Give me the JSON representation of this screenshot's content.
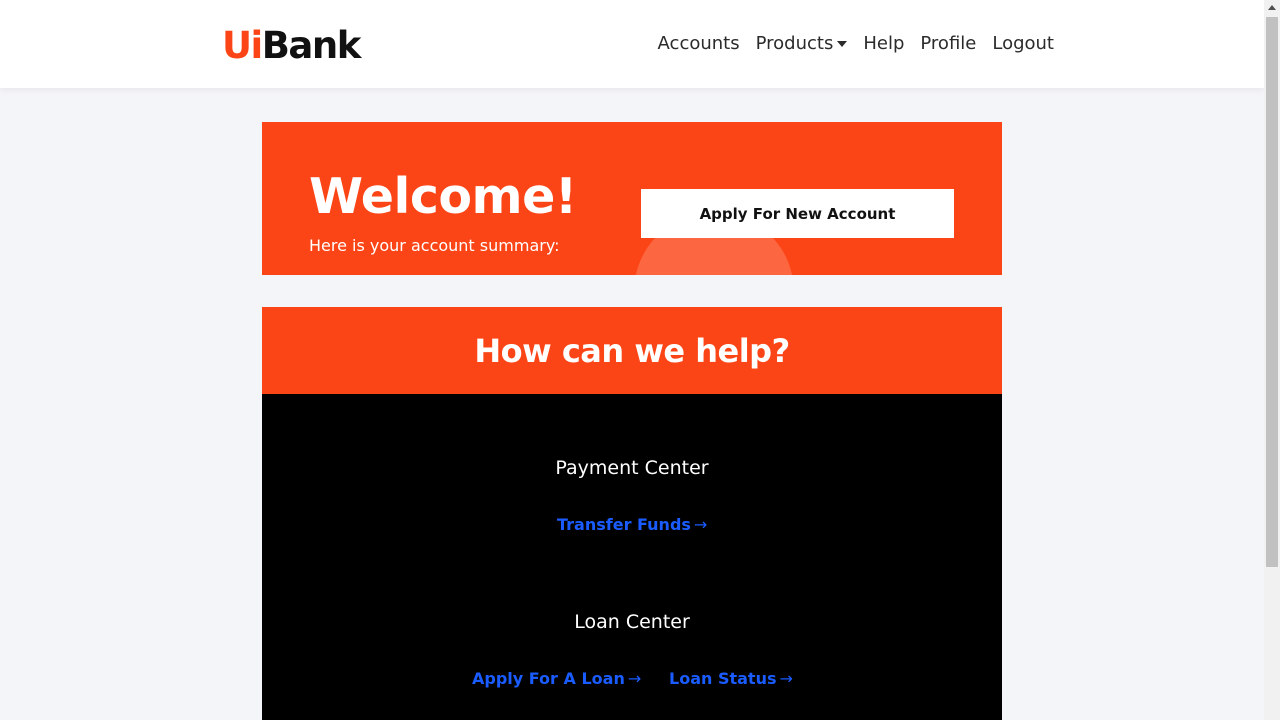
{
  "brand": {
    "logo_part1": "Ui",
    "logo_part2": "Bank",
    "accent": "#fc4516",
    "link_color": "#1a5cff"
  },
  "nav": {
    "accounts": "Accounts",
    "products": "Products",
    "help": "Help",
    "profile": "Profile",
    "logout": "Logout"
  },
  "welcome": {
    "title": "Welcome!",
    "subtitle": "Here is your account summary:",
    "apply_button": "Apply For New Account"
  },
  "help": {
    "title": "How can we help?",
    "payment_center": {
      "title": "Payment Center",
      "transfer_funds": "Transfer Funds"
    },
    "loan_center": {
      "title": "Loan Center",
      "apply_loan": "Apply For A Loan",
      "loan_status": "Loan Status"
    },
    "arrow_glyph": "→"
  }
}
